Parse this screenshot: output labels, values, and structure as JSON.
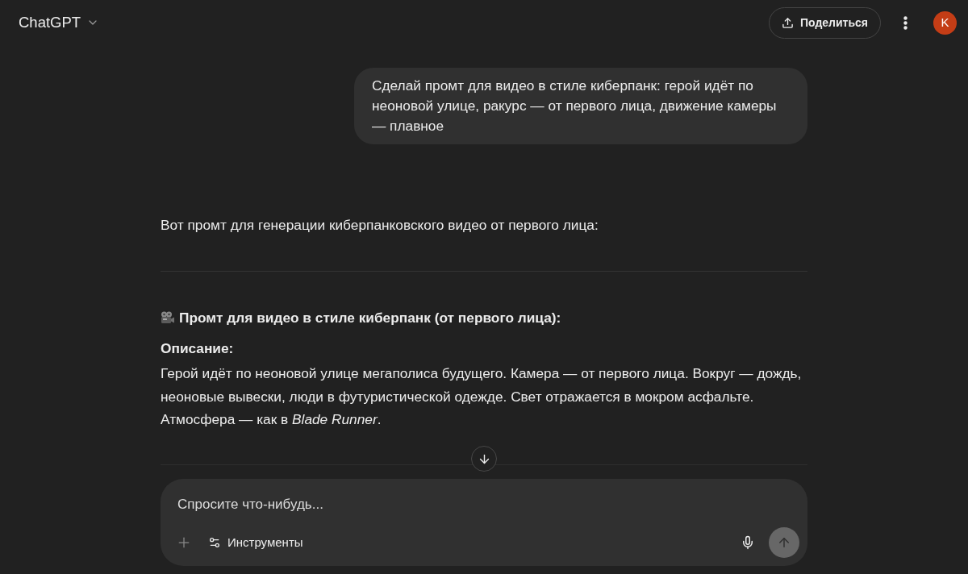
{
  "header": {
    "title": "ChatGPT",
    "share_button": "Поделиться",
    "avatar": "K"
  },
  "messages": [
    {
      "kind": "user_message",
      "text": "Сделай промт для видео в стиле киберпанк: герой идёт по неоновой улице, ракурс — от первого лица, движение камеры — плавное"
    },
    {
      "kind": "assistant_message",
      "blocks": [
        {
          "kind": "paragraph",
          "text": "Вот промт для генерации киберпанковского видео от первого лица:"
        },
        {
          "kind": "divider"
        },
        {
          "kind": "heading",
          "text": "Промт для видео в стиле киберпанк (от первого лица):"
        },
        {
          "kind": "label",
          "text": "Описание:"
        },
        {
          "kind": "body",
          "text": "Герой идёт по неоновой улице мегаполиса будущего. Камера — от первого лица. Вокруг — дождь, неоновые вывески, люди в футуристической одежде. Свет отражается в мокром асфальте. Атмосфера — как в *Blade Runner*."
        }
      ]
    }
  ],
  "composer": {
    "placeholder": "Спросите что-нибудь...",
    "tools_button": "Инструменты",
    "send_button": {
      "disabled": true
    }
  }
}
